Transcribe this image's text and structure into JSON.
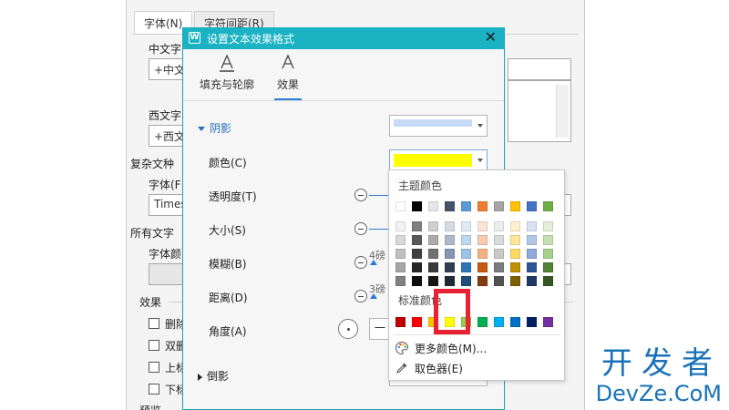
{
  "font_dialog": {
    "tabs": [
      "字体(N)",
      "字符间距(R)"
    ],
    "label_chinese": "中文字",
    "value_chinese": "+中文",
    "label_western": "西文字",
    "value_western": "+西文",
    "label_complex": "复杂文种",
    "label_font": "字体(F)",
    "value_font": "Times",
    "label_all": "所有文字",
    "label_font_color": "字体颜",
    "label_effects": "效果",
    "effects": [
      "删除",
      "双删",
      "上标",
      "下标"
    ],
    "label_preview": "预览"
  },
  "effect_dialog": {
    "title": "设置文本效果格式",
    "app_icon": "W",
    "tabs": [
      {
        "label": "填充与轮廓",
        "icon": "text-outline-icon"
      },
      {
        "label": "效果",
        "icon": "text-effect-icon"
      }
    ],
    "section_shadow": "阴影",
    "shadow_preset_color": "#c9daf8",
    "label_color": "颜色(C)",
    "color_value": "#ffff00",
    "label_transparency": "透明度(T)",
    "label_size": "大小(S)",
    "label_blur": "模糊(B)",
    "blur_value": "4磅",
    "label_distance": "距离(D)",
    "distance_value": "3磅",
    "label_angle": "角度(A)",
    "angle_value": "一",
    "section_reflection": "倒影"
  },
  "color_menu": {
    "theme_heading": "主题颜色",
    "theme_base": [
      "#ffffff",
      "#000000",
      "#e7e6e6",
      "#44546a",
      "#5b9bd5",
      "#ed7d31",
      "#a5a5a5",
      "#ffc000",
      "#4472c4",
      "#70ad47"
    ],
    "theme_tints": [
      [
        "#f2f2f2",
        "#7f7f7f",
        "#d0cece",
        "#d6dce4",
        "#deebf6",
        "#fbe5d5",
        "#ededed",
        "#fff2cc",
        "#d9e2f3",
        "#e2efd9"
      ],
      [
        "#d9d9d9",
        "#595959",
        "#aeabab",
        "#adb9ca",
        "#bdd7ee",
        "#f7cbac",
        "#dbdbdb",
        "#ffe599",
        "#b4c6e7",
        "#c5e0b3"
      ],
      [
        "#bfbfbf",
        "#404040",
        "#757070",
        "#8496b0",
        "#9dc3e6",
        "#f4b183",
        "#c9c9c9",
        "#ffd966",
        "#8eaadb",
        "#a8d08d"
      ],
      [
        "#a6a6a6",
        "#262626",
        "#3a3838",
        "#323f4f",
        "#2e75b5",
        "#c55a11",
        "#7b7b7b",
        "#bf9000",
        "#2f5496",
        "#538135"
      ],
      [
        "#808080",
        "#0d0d0d",
        "#171616",
        "#222a35",
        "#1f4e79",
        "#833c0b",
        "#525252",
        "#7f6000",
        "#1f3864",
        "#375623"
      ]
    ],
    "standard_heading": "标准颜色",
    "standard_colors": [
      "#c00000",
      "#ff0000",
      "#ffc000",
      "#ffff00",
      "#92d050",
      "#00b050",
      "#00b0f0",
      "#0070c0",
      "#002060",
      "#7030a0"
    ],
    "more_colors": "更多颜色(M)...",
    "eyedropper": "取色器(E)"
  },
  "watermark": {
    "cn": "开发者",
    "en": "DevZe.CoM"
  }
}
